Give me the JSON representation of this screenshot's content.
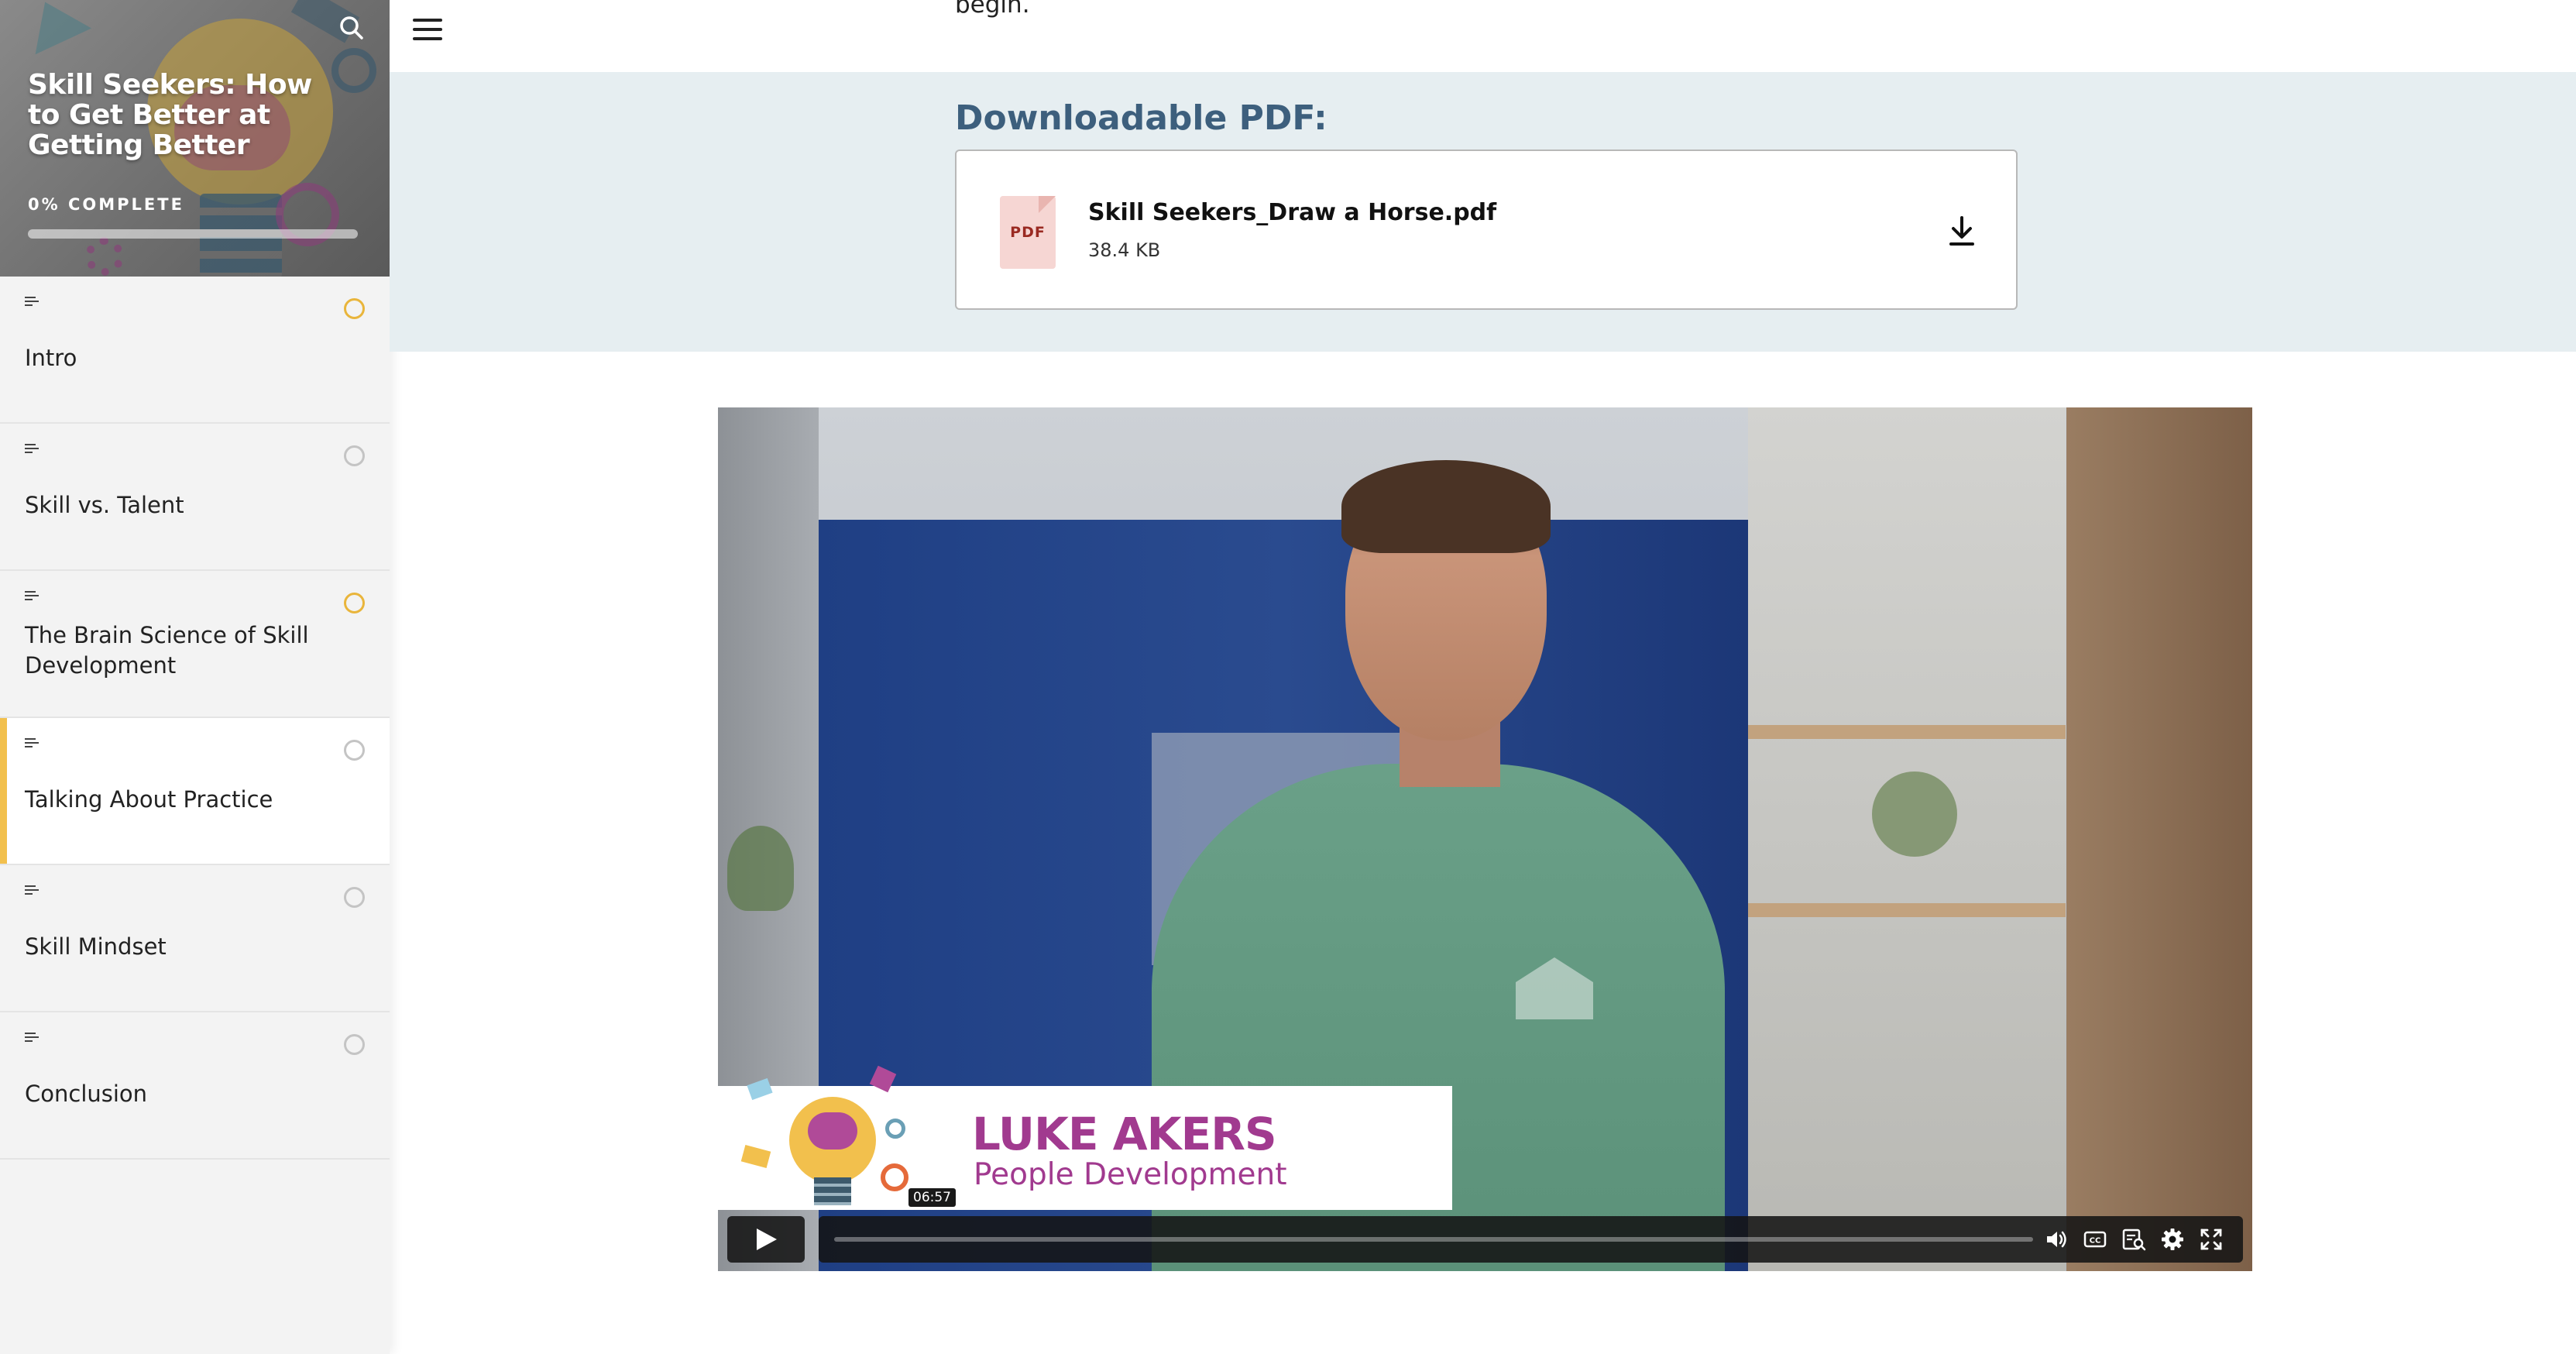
{
  "sidebar": {
    "course_title": "Skill Seekers: How to Get Better at Getting Better",
    "progress_label": "0% COMPLETE",
    "progress_fraction": 0.0,
    "lessons": [
      {
        "title": "Intro",
        "status": "in-progress",
        "active": false
      },
      {
        "title": "Skill vs. Talent",
        "status": "not-started",
        "active": false
      },
      {
        "title": "The Brain Science of Skill Development",
        "status": "in-progress",
        "active": false
      },
      {
        "title": "Talking About Practice",
        "status": "not-started",
        "active": true
      },
      {
        "title": "Skill Mindset",
        "status": "not-started",
        "active": false
      },
      {
        "title": "Conclusion",
        "status": "not-started",
        "active": false
      }
    ]
  },
  "main": {
    "previous_text": "begin.",
    "download_heading": "Downloadable PDF:",
    "file": {
      "type_label": "PDF",
      "name": "Skill Seekers_Draw a Horse.pdf",
      "size": "38.4 KB"
    },
    "video": {
      "lower_third_name": "LUKE AKERS",
      "lower_third_role": "People Development",
      "hover_time": "06:57",
      "progress_fraction": 0.0
    }
  },
  "colors": {
    "accent_yellow": "#f2c04d",
    "heading_blue": "#3d5f7d",
    "lower_third_purple": "#a13a8f"
  },
  "icons": {
    "search": "search-icon",
    "menu": "hamburger-menu-icon",
    "lesson_type": "text-lines-icon",
    "download": "download-icon",
    "volume": "volume-icon",
    "captions": "captions-icon",
    "transcript": "transcript-icon",
    "settings": "gear-icon",
    "fullscreen": "fullscreen-icon"
  }
}
